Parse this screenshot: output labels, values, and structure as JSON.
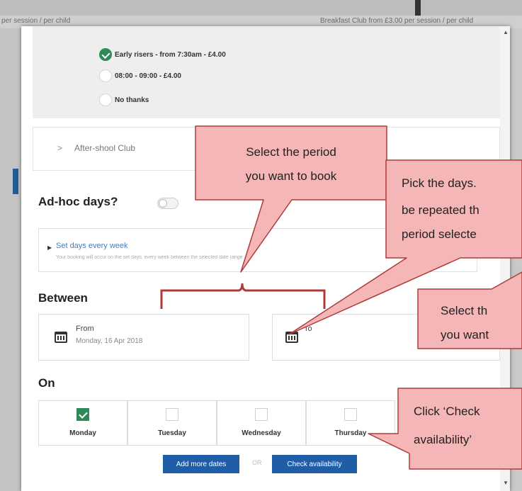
{
  "background": {
    "left_text": "per session / per child",
    "right_text": "Breakfast Club from £3.00 per session / per child"
  },
  "breakfast_options": [
    {
      "label": "Early risers - from 7:30am - £4.00",
      "checked": true
    },
    {
      "label": "08:00 - 09:00 - £4.00",
      "checked": false
    },
    {
      "label": "No thanks",
      "checked": false
    }
  ],
  "after_school": {
    "label": "After-shool Club"
  },
  "adhoc": {
    "label": "Ad-hoc days?"
  },
  "set_days": {
    "title": "Set days every week",
    "subtitle": "Your booking will occur on the set days, every week between the selected date range"
  },
  "between": {
    "label": "Between"
  },
  "date_from": {
    "label": "From",
    "value": "Monday, 16 Apr 2018"
  },
  "date_to": {
    "label": "To"
  },
  "on": {
    "label": "On"
  },
  "days": [
    {
      "name": "Monday",
      "checked": true
    },
    {
      "name": "Tuesday",
      "checked": false
    },
    {
      "name": "Wednesday",
      "checked": false
    },
    {
      "name": "Thursday",
      "checked": false
    }
  ],
  "buttons": {
    "add_more_dates": "Add more dates",
    "or": "OR",
    "check_availability": "Check availability"
  },
  "callouts": {
    "period": [
      "Select the period",
      "you want to book"
    ],
    "days_repeat": [
      "Pick the days.",
      "be repeated th",
      "period selecte"
    ],
    "select_the": [
      "Select th",
      "you want"
    ],
    "check": [
      "Click ‘Check",
      "availability’"
    ]
  },
  "colors": {
    "accent_blue": "#1f5ea7",
    "check_green": "#2e8b57",
    "callout_fill": "#f4b6b6",
    "callout_stroke": "#b03a3a"
  }
}
